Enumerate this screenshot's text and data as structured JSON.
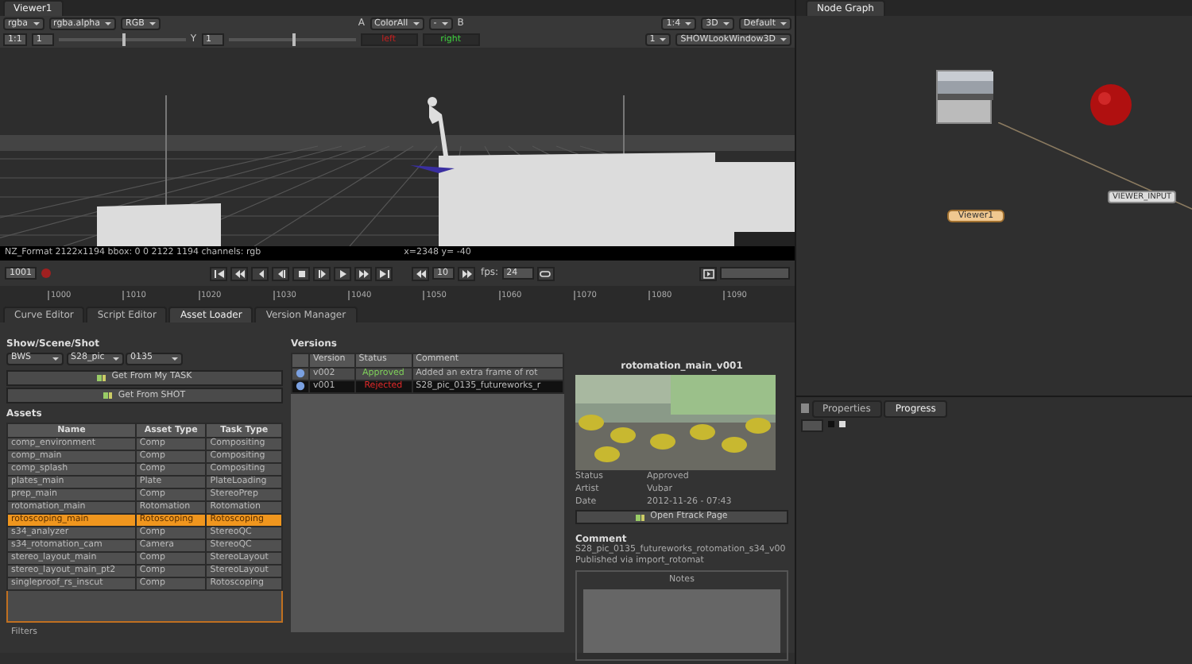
{
  "viewer": {
    "tab": "Viewer1",
    "toolbar_top": [
      {
        "kind": "dropdown",
        "text": "rgba"
      },
      {
        "kind": "dropdown",
        "text": "rgba.alpha"
      },
      {
        "kind": "dropdown",
        "text": "RGB"
      },
      {
        "kind": "spacer"
      },
      {
        "kind": "label",
        "text": "A"
      },
      {
        "kind": "dropdown",
        "text": "ColorAll"
      },
      {
        "kind": "dropdown",
        "text": "-"
      },
      {
        "kind": "label",
        "text": "B"
      },
      {
        "kind": "spacer"
      },
      {
        "kind": "dropdown",
        "text": "1:4"
      },
      {
        "kind": "dropdown",
        "text": "3D"
      },
      {
        "kind": "dropdown",
        "text": "Default"
      }
    ],
    "toolbar_bottom": [
      {
        "kind": "field",
        "text": "1:1"
      },
      {
        "kind": "field",
        "text": "1"
      },
      {
        "kind": "slider",
        "level": 0.5
      },
      {
        "kind": "label",
        "text": "Y"
      },
      {
        "kind": "field",
        "text": "1"
      },
      {
        "kind": "slider",
        "level": 0.5
      },
      {
        "kind": "button",
        "text": "left",
        "color": "#c42020"
      },
      {
        "kind": "button",
        "text": "right",
        "color": "#3fcf3f"
      },
      {
        "kind": "spacer"
      },
      {
        "kind": "dropdown",
        "text": "1"
      },
      {
        "kind": "dropdown",
        "text": "SHOWLookWindow3D"
      }
    ],
    "info": "NZ_Format 2122x1194 bbox: 0 0 2122 1194 channels: rgb",
    "coords": "x=2348 y= -40"
  },
  "playback": {
    "frame": "1001",
    "step": "10",
    "fps_label": "fps:",
    "fps": "24"
  },
  "timeline": {
    "ticks": [
      "1000",
      "1010",
      "1020",
      "1030",
      "1040",
      "1050",
      "1060",
      "1070",
      "1080",
      "1090"
    ]
  },
  "bottom_tabs": [
    {
      "label": "Curve Editor",
      "selected": false
    },
    {
      "label": "Script Editor",
      "selected": false
    },
    {
      "label": "Asset Loader",
      "selected": true
    },
    {
      "label": "Version Manager",
      "selected": false
    }
  ],
  "asset_loader": {
    "shot_label": "Show/Scene/Shot",
    "shot": [
      "BWS",
      "S28_pic",
      "0135"
    ],
    "buttons": [
      "Get From My TASK",
      "Get From SHOT"
    ],
    "assets_title": "Assets",
    "columns": [
      "Name",
      "Asset Type",
      "Task Type"
    ],
    "assets": [
      {
        "cells": [
          "comp_environment",
          "Comp",
          "Compositing"
        ],
        "selected": false
      },
      {
        "cells": [
          "comp_main",
          "Comp",
          "Compositing"
        ],
        "selected": false
      },
      {
        "cells": [
          "comp_splash",
          "Comp",
          "Compositing"
        ],
        "selected": false
      },
      {
        "cells": [
          "plates_main",
          "Plate",
          "PlateLoading"
        ],
        "selected": false
      },
      {
        "cells": [
          "prep_main",
          "Comp",
          "StereoPrep"
        ],
        "selected": false
      },
      {
        "cells": [
          "rotomation_main",
          "Rotomation",
          "Rotomation"
        ],
        "selected": false
      },
      {
        "cells": [
          "rotoscoping_main",
          "Rotoscoping",
          "Rotoscoping"
        ],
        "selected": true
      },
      {
        "cells": [
          "s34_analyzer",
          "Comp",
          "StereoQC"
        ],
        "selected": false
      },
      {
        "cells": [
          "s34_rotomation_cam",
          "Camera",
          "StereoQC"
        ],
        "selected": false
      },
      {
        "cells": [
          "stereo_layout_main",
          "Comp",
          "StereoLayout"
        ],
        "selected": false
      },
      {
        "cells": [
          "stereo_layout_main_pt2",
          "Comp",
          "StereoLayout"
        ],
        "selected": false
      },
      {
        "cells": [
          "singleproof_rs_inscut",
          "Comp",
          "Rotoscoping"
        ],
        "selected": false
      }
    ],
    "filters": "Filters",
    "versions_title": "Versions",
    "version_columns": [
      "Version",
      "Status",
      "Comment"
    ],
    "versions": [
      {
        "version": "v002",
        "status": "Approved",
        "kind": "approved",
        "comment": "Added an extra frame of rot",
        "selected": false
      },
      {
        "version": "v001",
        "status": "Rejected",
        "kind": "rejected",
        "comment": "S28_pic_0135_futureworks_r",
        "selected": true
      }
    ],
    "detail": {
      "title": "rotomation_main_v001",
      "fields": [
        {
          "label": "Status",
          "value": "Approved"
        },
        {
          "label": "Artist",
          "value": "Vubar"
        },
        {
          "label": "Date",
          "value": "2012-11-26 - 07:43"
        }
      ],
      "button": "Open Ftrack Page",
      "comment_title": "Comment",
      "comment": [
        "S28_pic_0135_futureworks_rotomation_s34_v00",
        "Published via import_rotomat"
      ],
      "notes": "Notes"
    }
  },
  "node_graph": {
    "tab": "Node Graph",
    "nodes": [
      {
        "kind": "read"
      },
      {
        "kind": "sphere"
      },
      {
        "kind": "viewer",
        "label": "Viewer1"
      },
      {
        "kind": "plain",
        "label": "VIEWER_INPUT"
      }
    ]
  },
  "properties": {
    "tabs": [
      {
        "label": "Properties",
        "selected": false
      },
      {
        "label": "Progress",
        "selected": true
      }
    ]
  }
}
